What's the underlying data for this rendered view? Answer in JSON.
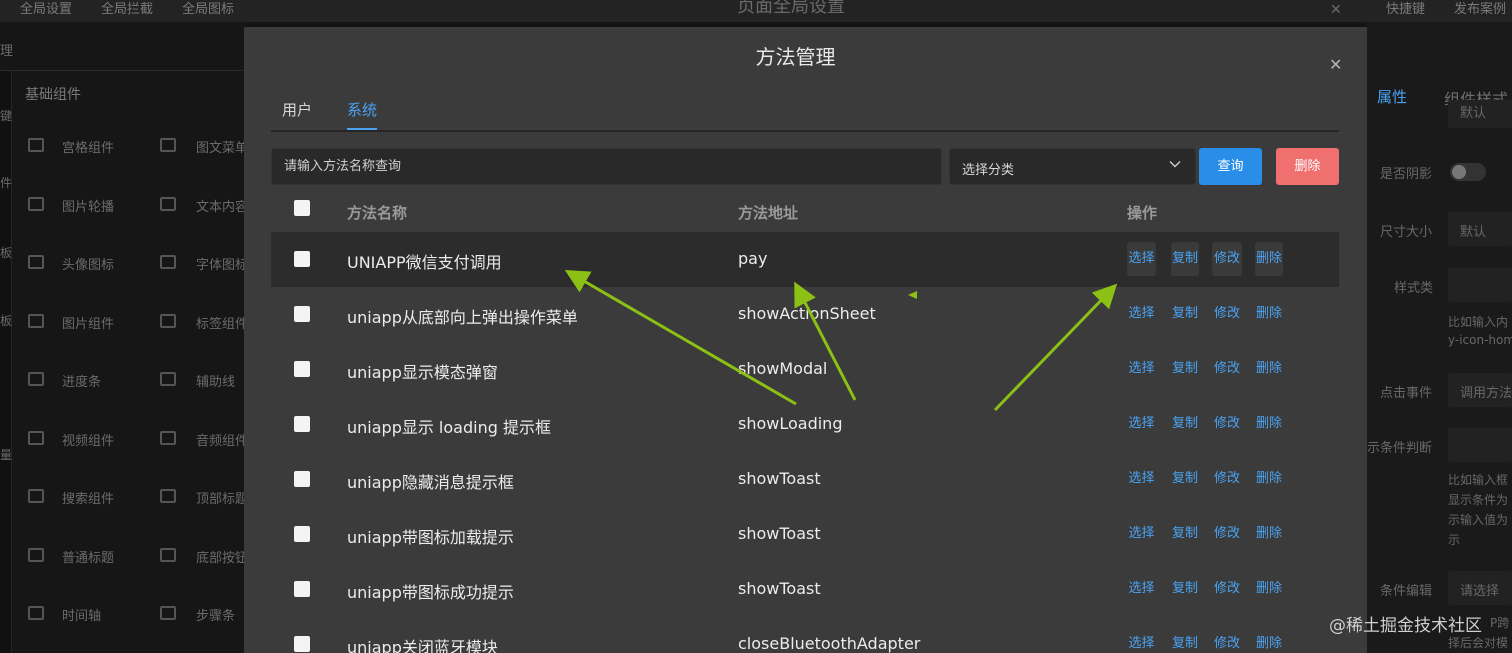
{
  "background": {
    "topnav": [
      "全局设置",
      "全局拦截",
      "全局图标"
    ],
    "topnav_right": [
      "快捷键",
      "发布案例"
    ],
    "dim_title": "页面全局设置",
    "left_panel": {
      "header_left": "理",
      "section_title": "基础组件",
      "strip_chars": [
        "键",
        "件",
        "板",
        "板",
        "量"
      ],
      "components": [
        [
          "宫格组件",
          "图文菜单"
        ],
        [
          "图片轮播",
          "文本内容"
        ],
        [
          "头像图标",
          "字体图标"
        ],
        [
          "图片组件",
          "标签组件"
        ],
        [
          "进度条",
          "辅助线"
        ],
        [
          "视频组件",
          "音频组件"
        ],
        [
          "搜索组件",
          "顶部标题"
        ],
        [
          "普通标题",
          "底部按钮"
        ],
        [
          "时间轴",
          "步骤条"
        ]
      ]
    },
    "right_panel": {
      "tabs": [
        "属性",
        "组件样式"
      ],
      "field_top": "默认",
      "rows": [
        "是否阴影",
        "尺寸大小",
        "样式类",
        "点击事件",
        "示条件判断",
        "条件编辑"
      ],
      "size_value": "默认",
      "hint1": [
        "比如输入内",
        "y-icon-hom"
      ],
      "click_value": "调用方法",
      "hint2": [
        "比如输入框",
        "显示条件为",
        "示输入值为",
        "示"
      ],
      "select_placeholder": "请选择",
      "hint3": [
        "P跨",
        "择后会对模"
      ]
    }
  },
  "modal": {
    "title": "方法管理",
    "tabs": [
      {
        "label": "用户",
        "active": false
      },
      {
        "label": "系统",
        "active": true
      }
    ],
    "search_placeholder": "请输入方法名称查询",
    "category_select": "选择分类",
    "query_button": "查询",
    "delete_button": "删除",
    "columns": {
      "name": "方法名称",
      "address": "方法地址",
      "actions": "操作"
    },
    "action_labels": [
      "选择",
      "复制",
      "修改",
      "删除"
    ],
    "rows": [
      {
        "name": "UNIAPP微信支付调用",
        "address": "pay",
        "highlighted": true
      },
      {
        "name": "uniapp从底部向上弹出操作菜单",
        "address": "showActionSheet",
        "highlighted": false
      },
      {
        "name": "uniapp显示模态弹窗",
        "address": "showModal",
        "highlighted": false
      },
      {
        "name": "uniapp显示 loading 提示框",
        "address": "showLoading",
        "highlighted": false
      },
      {
        "name": "uniapp隐藏消息提示框",
        "address": "showToast",
        "highlighted": false
      },
      {
        "name": "uniapp带图标加载提示",
        "address": "showToast",
        "highlighted": false
      },
      {
        "name": "uniapp带图标成功提示",
        "address": "showToast",
        "highlighted": false
      },
      {
        "name": "uniapp关闭蓝牙模块",
        "address": "closeBluetoothAdapter",
        "highlighted": false
      }
    ]
  },
  "annotation_color": "#8cc014",
  "accent_color": "#4aa3f2",
  "watermark": "@稀土掘金技术社区"
}
